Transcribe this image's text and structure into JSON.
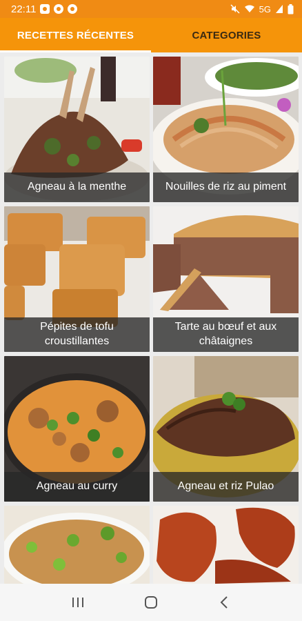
{
  "status_bar": {
    "time": "22:11",
    "signal_text": "5G"
  },
  "tabs": [
    {
      "label": "RECETTES RÉCENTES",
      "active": true
    },
    {
      "label": "CATEGORIES",
      "active": false
    }
  ],
  "recipes": [
    {
      "title": "Agneau à la menthe"
    },
    {
      "title": "Nouilles de riz au piment"
    },
    {
      "title": "Pépites de tofu croustillantes"
    },
    {
      "title": "Tarte au bœuf et aux châtaignes"
    },
    {
      "title": "Agneau au curry"
    },
    {
      "title": "Agneau et riz Pulao"
    },
    {
      "title": ""
    },
    {
      "title": ""
    }
  ],
  "colors": {
    "accent": "#f5940a",
    "status": "#f08b14"
  },
  "nav": {
    "recents_icon": "recent-apps-icon",
    "home_icon": "home-icon",
    "back_icon": "back-icon"
  }
}
